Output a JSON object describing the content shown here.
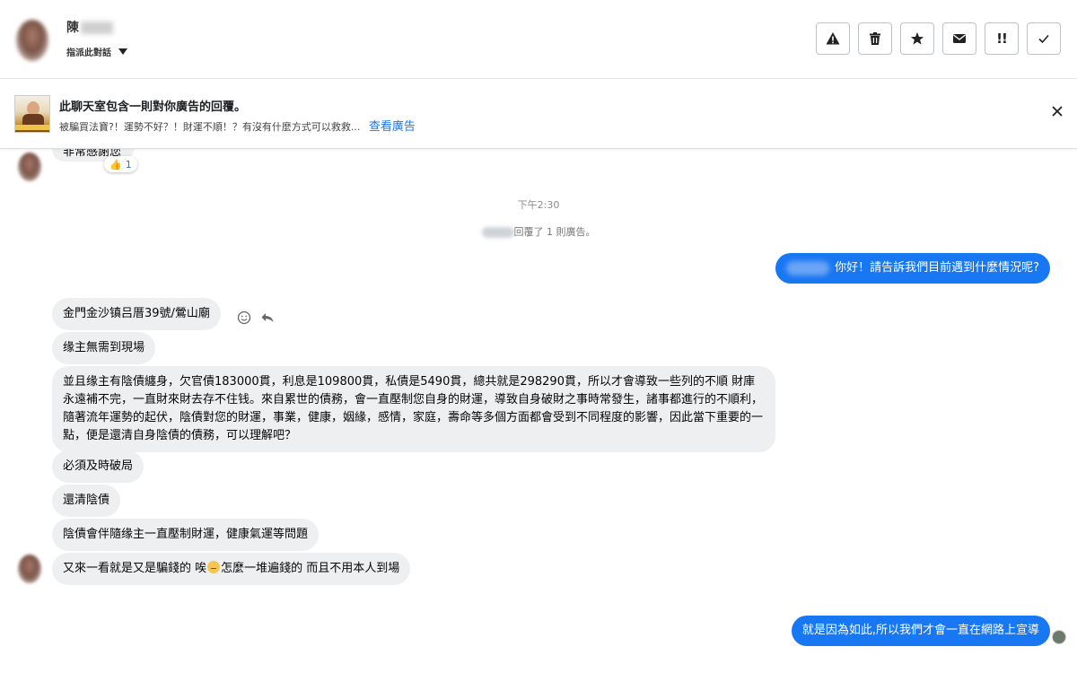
{
  "header": {
    "contact_name": "陳",
    "assign_label": "指派此對話",
    "toolbar": [
      {
        "name": "spam-button",
        "icon": "warning-icon"
      },
      {
        "name": "delete-button",
        "icon": "trash-icon"
      },
      {
        "name": "star-button",
        "icon": "star-icon"
      },
      {
        "name": "mark-unread-button",
        "icon": "envelope-icon"
      },
      {
        "name": "mark-follow-up-button",
        "icon": "follow-up-icon",
        "glyph": "!!"
      },
      {
        "name": "mark-done-button",
        "icon": "check-icon"
      }
    ]
  },
  "ad_banner": {
    "title": "此聊天室包含一則對你廣告的回覆。",
    "subtitle": "被騙買法寶?！運勢不好？！財運不順！？有沒有什麼方式可以救救...",
    "link": "查看廣告"
  },
  "chat": {
    "partial_message": "非常感謝您",
    "reaction_count": "1",
    "timestamp": "下午2:30",
    "system_message": "回覆了 1 則廣告。",
    "outgoing_1": "你好！請告訴我們目前遇到什麼情況呢?",
    "incoming": [
      "金門金沙镇吕厝39號/鶯山廟",
      "缘主無需到現場",
      "並且缘主有陰債纏身，欠官債183000貫，利息是109800貫，私債是5490貫，總共就是298290貫，所以才會導致一些列的不順 財庫永遠補不完，一直財來財去存不住钱。來自累世的債務，會一直壓制您自身的財運，導致自身破財之事時常發生，諸事都進行的不順利，隨著流年運勢的起伏，陰債對您的財運，事業，健康，姻緣，感情，家庭，壽命等多個方面都會受到不同程度的影響，因此當下重要的一點，便是還清自身陰債的債務，可以理解吧？",
      "必須及時破局",
      "還清陰債",
      "陰債會伴隨缘主一直壓制財運，健康氣運等問題"
    ],
    "incoming_last_before": "又來一看就是又是騙錢的 唉",
    "incoming_last_after": "怎麼一堆遍錢的 而且不用本人到場",
    "outgoing_2": "就是因為如此,所以我們才會一直在網路上宣導"
  },
  "colors": {
    "outgoing_bubble": "#1877f2",
    "incoming_bubble": "#eeeff1",
    "link": "#1877f2"
  }
}
